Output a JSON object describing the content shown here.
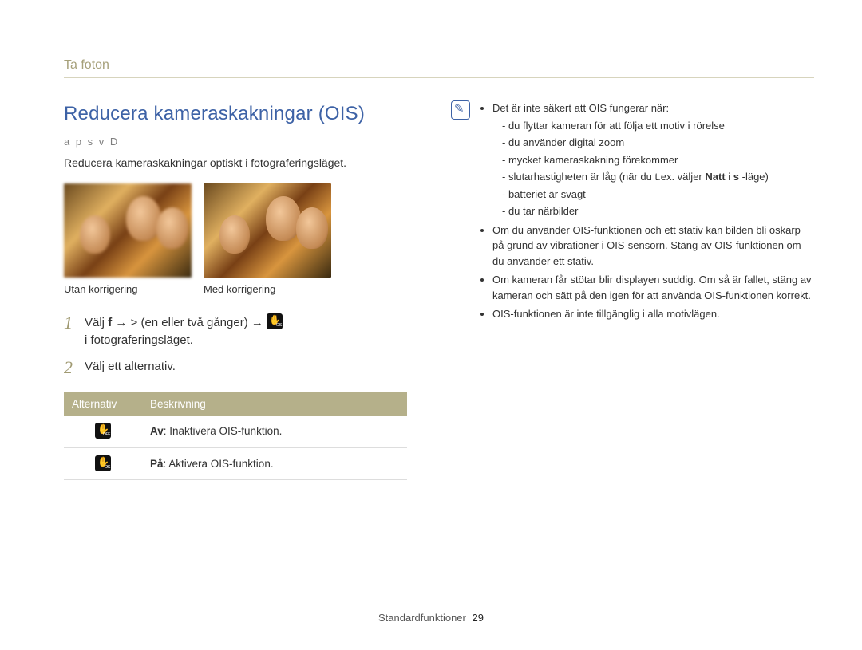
{
  "breadcrumb": "Ta foton",
  "title": "Reducera kameraskakningar (OIS)",
  "modes": "a p s v D",
  "intro": "Reducera kameraskakningar optiskt i fotograferingsläget.",
  "caption_left": "Utan korrigering",
  "caption_right": "Med korrigering",
  "steps": {
    "s1_a": "Välj ",
    "s1_sym_f": "f",
    "s1_arrow": "   →  > ",
    "s1_mid": " (en eller två gånger) → ",
    "s1_tail": " i fotograferingsläget.",
    "s2": "Välj ett alternativ."
  },
  "table": {
    "h1": "Alternativ",
    "h2": "Beskrivning",
    "row1_bold": "Av",
    "row1_rest": ": Inaktivera OIS-funktion.",
    "row2_bold": "På",
    "row2_rest": ": Aktivera OIS-funktion."
  },
  "notes": {
    "intro": "Det är inte säkert att OIS fungerar när:",
    "d1": "du flyttar kameran för att följa ett motiv i rörelse",
    "d2": "du använder digital zoom",
    "d3": "mycket kameraskakning förekommer",
    "d4_a": "slutarhastigheten är låg (när du t.ex. väljer ",
    "d4_bold": "Natt",
    "d4_b": " i ",
    "d4_sym": "s",
    "d4_c": "   -läge)",
    "d5": "batteriet är svagt",
    "d6": "du tar närbilder",
    "n2": "Om du använder OIS-funktionen och ett stativ kan bilden bli oskarp på grund av vibrationer i OIS-sensorn. Stäng av OIS-funktionen om du använder ett stativ.",
    "n3": "Om kameran får stötar blir displayen suddig. Om så är fallet, stäng av kameran och sätt på den igen för att använda OIS-funktionen korrekt.",
    "n4": "OIS-funktionen är inte tillgänglig i alla motivlägen."
  },
  "footer_label": "Standardfunktioner",
  "page_number": "29"
}
